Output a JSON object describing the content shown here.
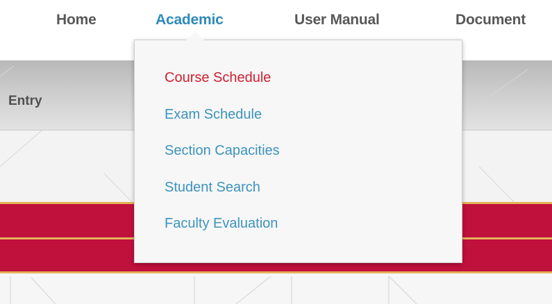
{
  "nav": {
    "items": [
      {
        "label": "Home"
      },
      {
        "label": "Academic",
        "active": true
      },
      {
        "label": "User Manual"
      },
      {
        "label": "Document"
      }
    ]
  },
  "background": {
    "entry_label": "Entry"
  },
  "dropdown": {
    "items": [
      {
        "label": "Course Schedule",
        "highlighted": true
      },
      {
        "label": "Exam Schedule"
      },
      {
        "label": "Section Capacities"
      },
      {
        "label": "Student Search"
      },
      {
        "label": "Faculty Evaluation"
      }
    ]
  },
  "colors": {
    "nav_text": "#575757",
    "nav_active": "#2e8ab8",
    "menu_link": "#3c93bd",
    "menu_highlight": "#d01f2f",
    "banner_red": "#c0103c",
    "banner_gold": "#e6b25a"
  }
}
